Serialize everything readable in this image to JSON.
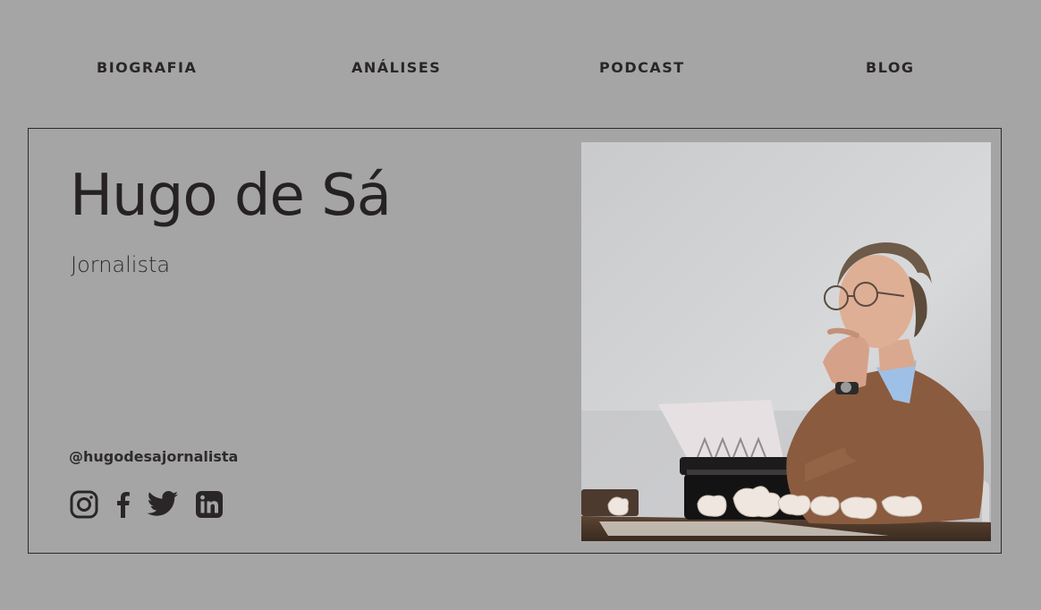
{
  "nav": {
    "items": [
      {
        "label": "BIOGRAFIA"
      },
      {
        "label": "ANÁLISES"
      },
      {
        "label": "PODCAST"
      },
      {
        "label": "BLOG"
      }
    ]
  },
  "profile": {
    "name": "Hugo de Sá",
    "role": "Jornalista",
    "handle": "@hugodesajornalista"
  },
  "social": {
    "icons": [
      "instagram-icon",
      "facebook-icon",
      "twitter-icon",
      "linkedin-icon"
    ]
  },
  "photo": {
    "subject": "man-at-typewriter"
  },
  "colors": {
    "background": "#a5a5a5",
    "text": "#2a2628",
    "border": "#2b2b2b"
  }
}
